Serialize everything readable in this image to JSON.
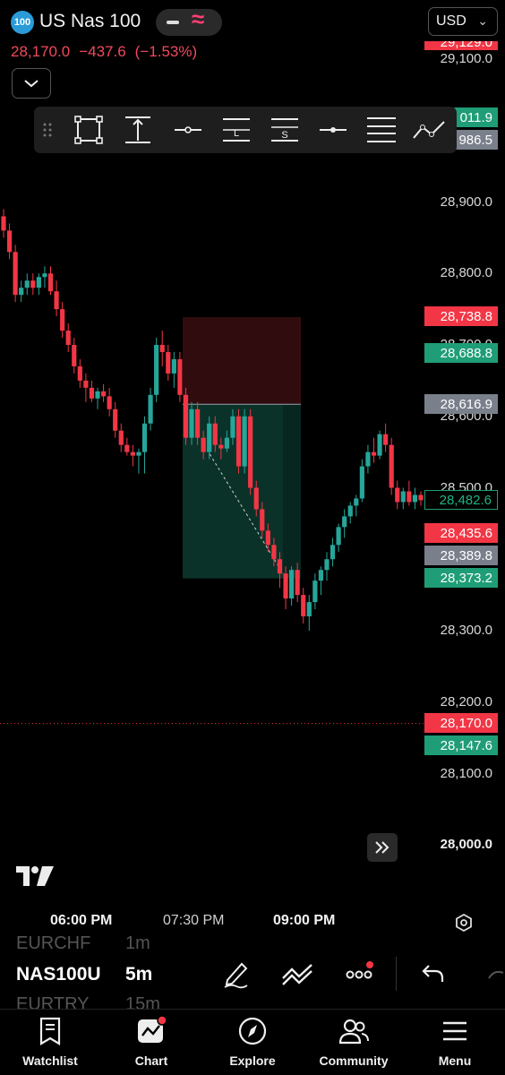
{
  "header": {
    "symbol_badge": "100",
    "symbol_name": "US Nas 100",
    "currency": "USD",
    "last_price": "28,170.0",
    "change": "−437.6",
    "change_pct": "(−1.53%)"
  },
  "drawing_toolbar": {
    "tools": [
      "drag-handle",
      "rectangle",
      "range",
      "horizontal-line",
      "long-position",
      "short-position",
      "horizontal-ray",
      "parallel-channel",
      "trend-line"
    ],
    "short_label": "L",
    "sell_label": "S"
  },
  "price_axis": {
    "labels": [
      "29,100.0",
      "28,900.0",
      "28,800.0",
      "28,700.0",
      "28,600.0",
      "28,500.0",
      "28,300.0",
      "28,200.0",
      "28,100.0",
      "28,000.0"
    ],
    "tags": [
      {
        "value": "011.9",
        "color": "#1f9d76"
      },
      {
        "value": "986.5",
        "color": "#7a7f8c"
      },
      {
        "value": "28,738.8",
        "color": "#f23645"
      },
      {
        "value": "28,688.8",
        "color": "#1f9d76"
      },
      {
        "value": "28,616.9",
        "color": "#7a7f8c"
      },
      {
        "value": "28,482.6",
        "color": "#1f9d76"
      },
      {
        "value": "28,435.6",
        "color": "#f23645"
      },
      {
        "value": "28,389.8",
        "color": "#7a7f8c"
      },
      {
        "value": "28,373.2",
        "color": "#1f9d76"
      },
      {
        "value": "28,170.0",
        "color": "#f23645"
      },
      {
        "value": "28,147.6",
        "color": "#1f9d76"
      }
    ],
    "top_clipped": "29,129.0"
  },
  "time_axis": {
    "labels": [
      "06:00 PM",
      "07:30 PM",
      "09:00 PM"
    ]
  },
  "colors": {
    "up": "#26a69a",
    "down": "#f23645",
    "stop_zone": "#3a0e12",
    "target_zone": "#082822"
  },
  "bottom_toolbar": {
    "symbol_prev": "EURCHF",
    "symbol": "NAS100U",
    "symbol_next": "EURTRY",
    "interval_prev": "1m",
    "interval": "5m",
    "interval_next": "15m"
  },
  "nav": {
    "items": [
      {
        "label": "Watchlist",
        "icon": "watchlist-icon"
      },
      {
        "label": "Chart",
        "icon": "chart-icon"
      },
      {
        "label": "Explore",
        "icon": "compass-icon"
      },
      {
        "label": "Community",
        "icon": "community-icon"
      },
      {
        "label": "Menu",
        "icon": "menu-icon"
      }
    ]
  },
  "chart_data": {
    "type": "candlestick",
    "ylim": [
      27950,
      29150
    ],
    "candles": [
      [
        28880,
        28890,
        28850,
        28860
      ],
      [
        28860,
        28870,
        28820,
        28830
      ],
      [
        28830,
        28840,
        28760,
        28770
      ],
      [
        28770,
        28790,
        28760,
        28780
      ],
      [
        28780,
        28800,
        28770,
        28790
      ],
      [
        28790,
        28800,
        28770,
        28780
      ],
      [
        28780,
        28800,
        28770,
        28795
      ],
      [
        28795,
        28810,
        28780,
        28800
      ],
      [
        28800,
        28810,
        28770,
        28775
      ],
      [
        28775,
        28790,
        28740,
        28750
      ],
      [
        28750,
        28760,
        28710,
        28720
      ],
      [
        28720,
        28730,
        28690,
        28700
      ],
      [
        28700,
        28710,
        28660,
        28670
      ],
      [
        28670,
        28680,
        28640,
        28650
      ],
      [
        28650,
        28660,
        28620,
        28640
      ],
      [
        28640,
        28650,
        28620,
        28625
      ],
      [
        28625,
        28640,
        28610,
        28635
      ],
      [
        28635,
        28645,
        28620,
        28628
      ],
      [
        28628,
        28640,
        28600,
        28610
      ],
      [
        28610,
        28620,
        28570,
        28580
      ],
      [
        28580,
        28590,
        28550,
        28560
      ],
      [
        28560,
        28570,
        28545,
        28550
      ],
      [
        28550,
        28560,
        28530,
        28545
      ],
      [
        28545,
        28555,
        28520,
        28550
      ],
      [
        28550,
        28600,
        28520,
        28590
      ],
      [
        28590,
        28640,
        28580,
        28630
      ],
      [
        28630,
        28710,
        28620,
        28700
      ],
      [
        28700,
        28720,
        28670,
        28690
      ],
      [
        28690,
        28700,
        28650,
        28660
      ],
      [
        28660,
        28690,
        28640,
        28680
      ],
      [
        28680,
        28690,
        28620,
        28630
      ],
      [
        28630,
        28640,
        28560,
        28570
      ],
      [
        28570,
        28620,
        28560,
        28610
      ],
      [
        28610,
        28620,
        28560,
        28570
      ],
      [
        28570,
        28580,
        28540,
        28550
      ],
      [
        28550,
        28600,
        28540,
        28590
      ],
      [
        28590,
        28600,
        28550,
        28560
      ],
      [
        28560,
        28570,
        28540,
        28555
      ],
      [
        28555,
        28580,
        28550,
        28570
      ],
      [
        28570,
        28610,
        28560,
        28600
      ],
      [
        28600,
        28610,
        28520,
        28530
      ],
      [
        28530,
        28610,
        28520,
        28600
      ],
      [
        28600,
        28610,
        28490,
        28500
      ],
      [
        28500,
        28510,
        28460,
        28470
      ],
      [
        28470,
        28480,
        28430,
        28440
      ],
      [
        28440,
        28450,
        28410,
        28420
      ],
      [
        28420,
        28430,
        28390,
        28400
      ],
      [
        28400,
        28410,
        28360,
        28380
      ],
      [
        28380,
        28390,
        28330,
        28345
      ],
      [
        28345,
        28390,
        28335,
        28385
      ],
      [
        28385,
        28395,
        28340,
        28350
      ],
      [
        28350,
        28360,
        28310,
        28320
      ],
      [
        28320,
        28350,
        28300,
        28340
      ],
      [
        28340,
        28380,
        28330,
        28370
      ],
      [
        28370,
        28390,
        28350,
        28385
      ],
      [
        28385,
        28410,
        28370,
        28400
      ],
      [
        28400,
        28430,
        28390,
        28420
      ],
      [
        28420,
        28450,
        28410,
        28445
      ],
      [
        28445,
        28470,
        28430,
        28460
      ],
      [
        28460,
        28480,
        28450,
        28475
      ],
      [
        28475,
        28490,
        28460,
        28485
      ],
      [
        28485,
        28540,
        28480,
        28530
      ],
      [
        28530,
        28560,
        28520,
        28550
      ],
      [
        28550,
        28570,
        28535,
        28545
      ],
      [
        28545,
        28580,
        28540,
        28575
      ],
      [
        28575,
        28590,
        28550,
        28560
      ],
      [
        28560,
        28570,
        28490,
        28500
      ],
      [
        28500,
        28510,
        28470,
        28480
      ],
      [
        28480,
        28500,
        28470,
        28495
      ],
      [
        28495,
        28510,
        28475,
        28480
      ],
      [
        28480,
        28500,
        28470,
        28490
      ],
      [
        28490,
        28495,
        28475,
        28482.6
      ]
    ],
    "position_tool": {
      "entry": 28616.9,
      "stop": 28738.8,
      "target": 28373.2
    }
  }
}
